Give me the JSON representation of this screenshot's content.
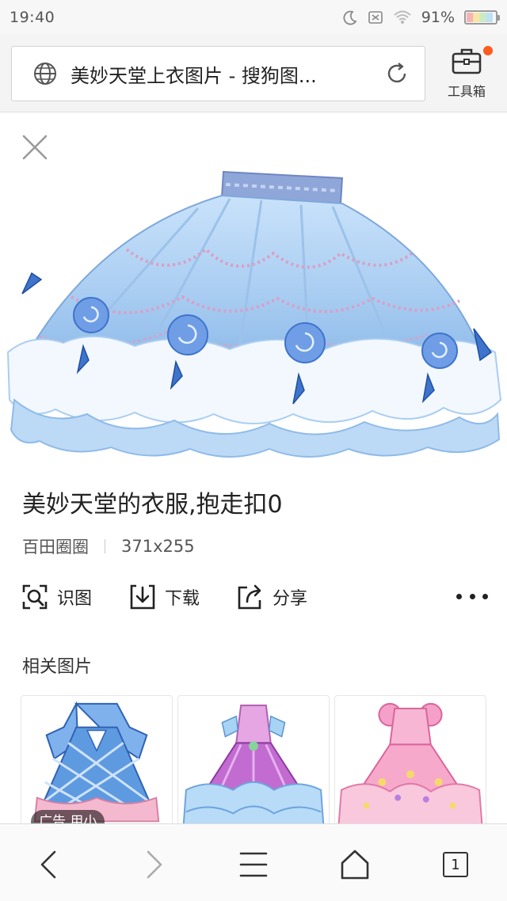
{
  "status_bar": {
    "time": "19:40",
    "battery_percent": "91%",
    "battery_level": 0.91
  },
  "address_bar": {
    "url_title": "美妙天堂上衣图片 - 搜狗图...",
    "toolbox_label": "工具箱"
  },
  "image_detail": {
    "title": "美妙天堂的衣服,抱走扣0",
    "source": "百田圈圈",
    "dimensions": "371x255"
  },
  "actions": {
    "recognize_label": "识图",
    "download_label": "下载",
    "share_label": "分享"
  },
  "related": {
    "heading": "相关图片",
    "ad_badge": "广告  用小"
  },
  "bottom_nav": {
    "tab_count": "1"
  },
  "colors": {
    "accent_dot": "#ff5a1f",
    "skirt_blue": "#a9cdf2",
    "skirt_pink": "#d99fc6"
  }
}
